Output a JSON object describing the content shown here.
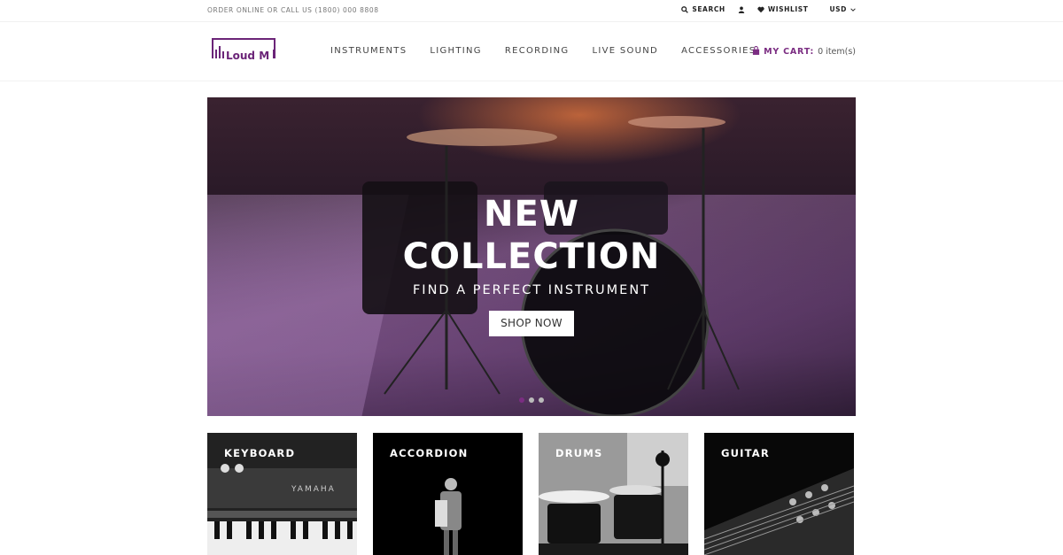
{
  "topbar": {
    "promo": "ORDER ONLINE OR CALL US (1800) 000 8808",
    "search": "SEARCH",
    "wishlist": "WISHLIST",
    "currency": "USD"
  },
  "logo": {
    "text": "Loud M"
  },
  "nav": {
    "items": [
      "INSTRUMENTS",
      "LIGHTING",
      "RECORDING",
      "LIVE SOUND",
      "ACCESSORIES"
    ]
  },
  "cart": {
    "label": "MY CART:",
    "count": "0 item(s)"
  },
  "hero": {
    "title_line1": "NEW",
    "title_line2": "COLLECTION",
    "subtitle": "FIND A PERFECT INSTRUMENT",
    "button": "SHOP NOW",
    "slides": 3,
    "active_slide": 1
  },
  "categories": [
    {
      "label": "KEYBOARD"
    },
    {
      "label": "ACCORDION"
    },
    {
      "label": "DRUMS"
    },
    {
      "label": "GUITAR"
    }
  ],
  "colors": {
    "accent": "#7b2d82"
  }
}
